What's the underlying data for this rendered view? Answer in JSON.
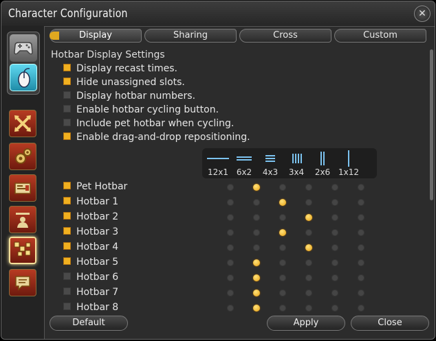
{
  "window": {
    "title": "Character Configuration"
  },
  "tabs": [
    {
      "label": "Display",
      "active": true
    },
    {
      "label": "Sharing",
      "active": false
    },
    {
      "label": "Cross",
      "active": false
    },
    {
      "label": "Custom",
      "active": false
    }
  ],
  "section": {
    "title": "Hotbar Display Settings"
  },
  "options": [
    {
      "label": "Display recast times.",
      "checked": true
    },
    {
      "label": "Hide unassigned slots.",
      "checked": true
    },
    {
      "label": "Display hotbar numbers.",
      "checked": false
    },
    {
      "label": "Enable hotbar cycling button.",
      "checked": false
    },
    {
      "label": "Include pet hotbar when cycling.",
      "checked": false
    },
    {
      "label": "Enable drag-and-drop repositioning.",
      "checked": true
    }
  ],
  "layouts": [
    "12x1",
    "6x2",
    "4x3",
    "3x4",
    "2x6",
    "1x12"
  ],
  "hotbars": [
    {
      "label": "Pet Hotbar",
      "checked": true,
      "layout": "6x2"
    },
    {
      "label": "Hotbar 1",
      "checked": true,
      "layout": "4x3"
    },
    {
      "label": "Hotbar 2",
      "checked": true,
      "layout": "3x4"
    },
    {
      "label": "Hotbar 3",
      "checked": true,
      "layout": "4x3"
    },
    {
      "label": "Hotbar 4",
      "checked": true,
      "layout": "3x4"
    },
    {
      "label": "Hotbar 5",
      "checked": true,
      "layout": "6x2"
    },
    {
      "label": "Hotbar 6",
      "checked": false,
      "layout": "6x2"
    },
    {
      "label": "Hotbar 7",
      "checked": false,
      "layout": "6x2"
    },
    {
      "label": "Hotbar 8",
      "checked": false,
      "layout": "6x2"
    }
  ],
  "sidebar": {
    "modes": [
      "gamepad-icon",
      "mouse-icon"
    ],
    "categories": [
      "crossed-arrows-icon",
      "gears-icon",
      "id-card-icon",
      "character-icon",
      "hotbar-icon",
      "chat-bubble-icon"
    ],
    "active_category": "hotbar-icon"
  },
  "footer": {
    "default_label": "Default",
    "apply_label": "Apply",
    "close_label": "Close"
  },
  "colors": {
    "accent": "#f0b020",
    "panel": "#2c2c2c",
    "category_button": "#b73b22",
    "layout_icon": "#7cc3f0"
  }
}
